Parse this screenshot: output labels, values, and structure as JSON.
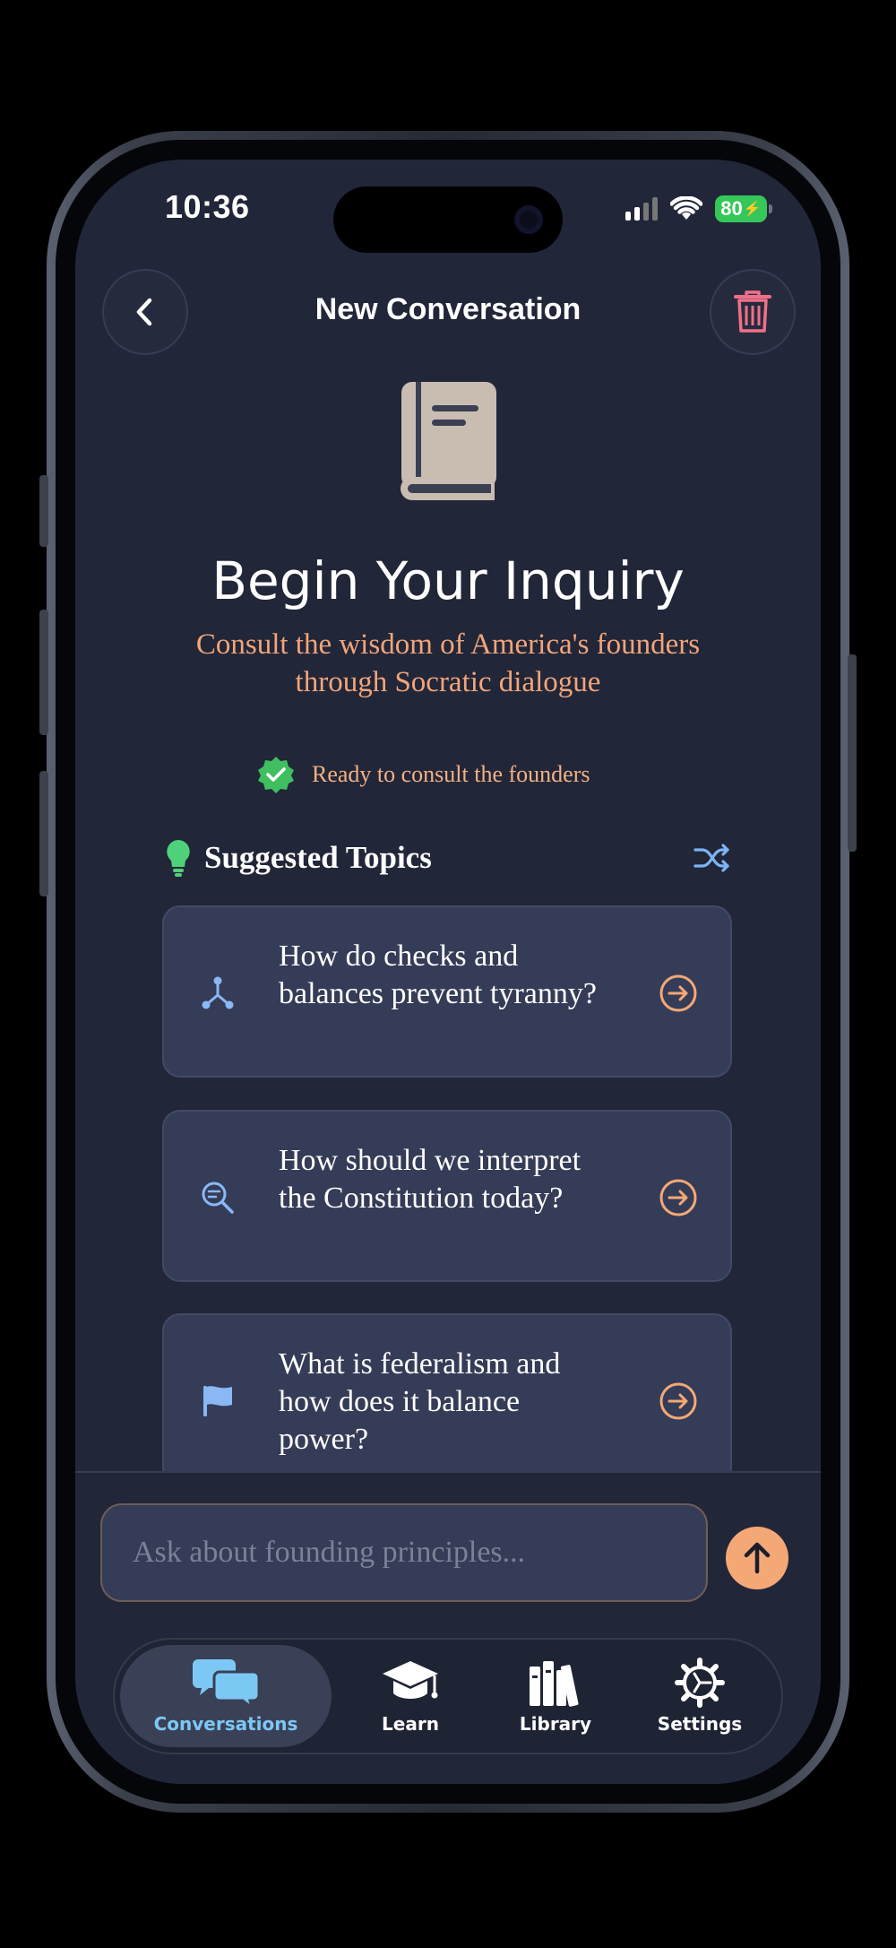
{
  "status_bar": {
    "time": "10:36",
    "battery": "80"
  },
  "header": {
    "title": "New Conversation"
  },
  "hero": {
    "title": "Begin Your Inquiry",
    "subtitle": "Consult the wisdom of America's founders through Socratic dialogue",
    "status": "Ready to consult the founders"
  },
  "topics": {
    "heading": "Suggested Topics",
    "items": [
      {
        "icon": "network-icon",
        "text": "How do checks and balances prevent tyranny?"
      },
      {
        "icon": "search-icon",
        "text": "How should we interpret the Constitution today?"
      },
      {
        "icon": "flag-icon",
        "text": "What is federalism and how does it balance power?"
      }
    ]
  },
  "composer": {
    "placeholder": "Ask about founding principles..."
  },
  "tabs": [
    {
      "label": "Conversations",
      "icon": "chat-bubbles-icon",
      "active": true
    },
    {
      "label": "Learn",
      "icon": "graduation-cap-icon",
      "active": false
    },
    {
      "label": "Library",
      "icon": "books-icon",
      "active": false
    },
    {
      "label": "Settings",
      "icon": "gear-icon",
      "active": false
    }
  ],
  "colors": {
    "background": "#212638",
    "card": "#353c57",
    "accent": "#f4a876",
    "tab_active": "#7cc8f5",
    "ready_badge": "#3fbf5f",
    "delete": "#f07088",
    "topic_icon": "#8ab8f5"
  }
}
